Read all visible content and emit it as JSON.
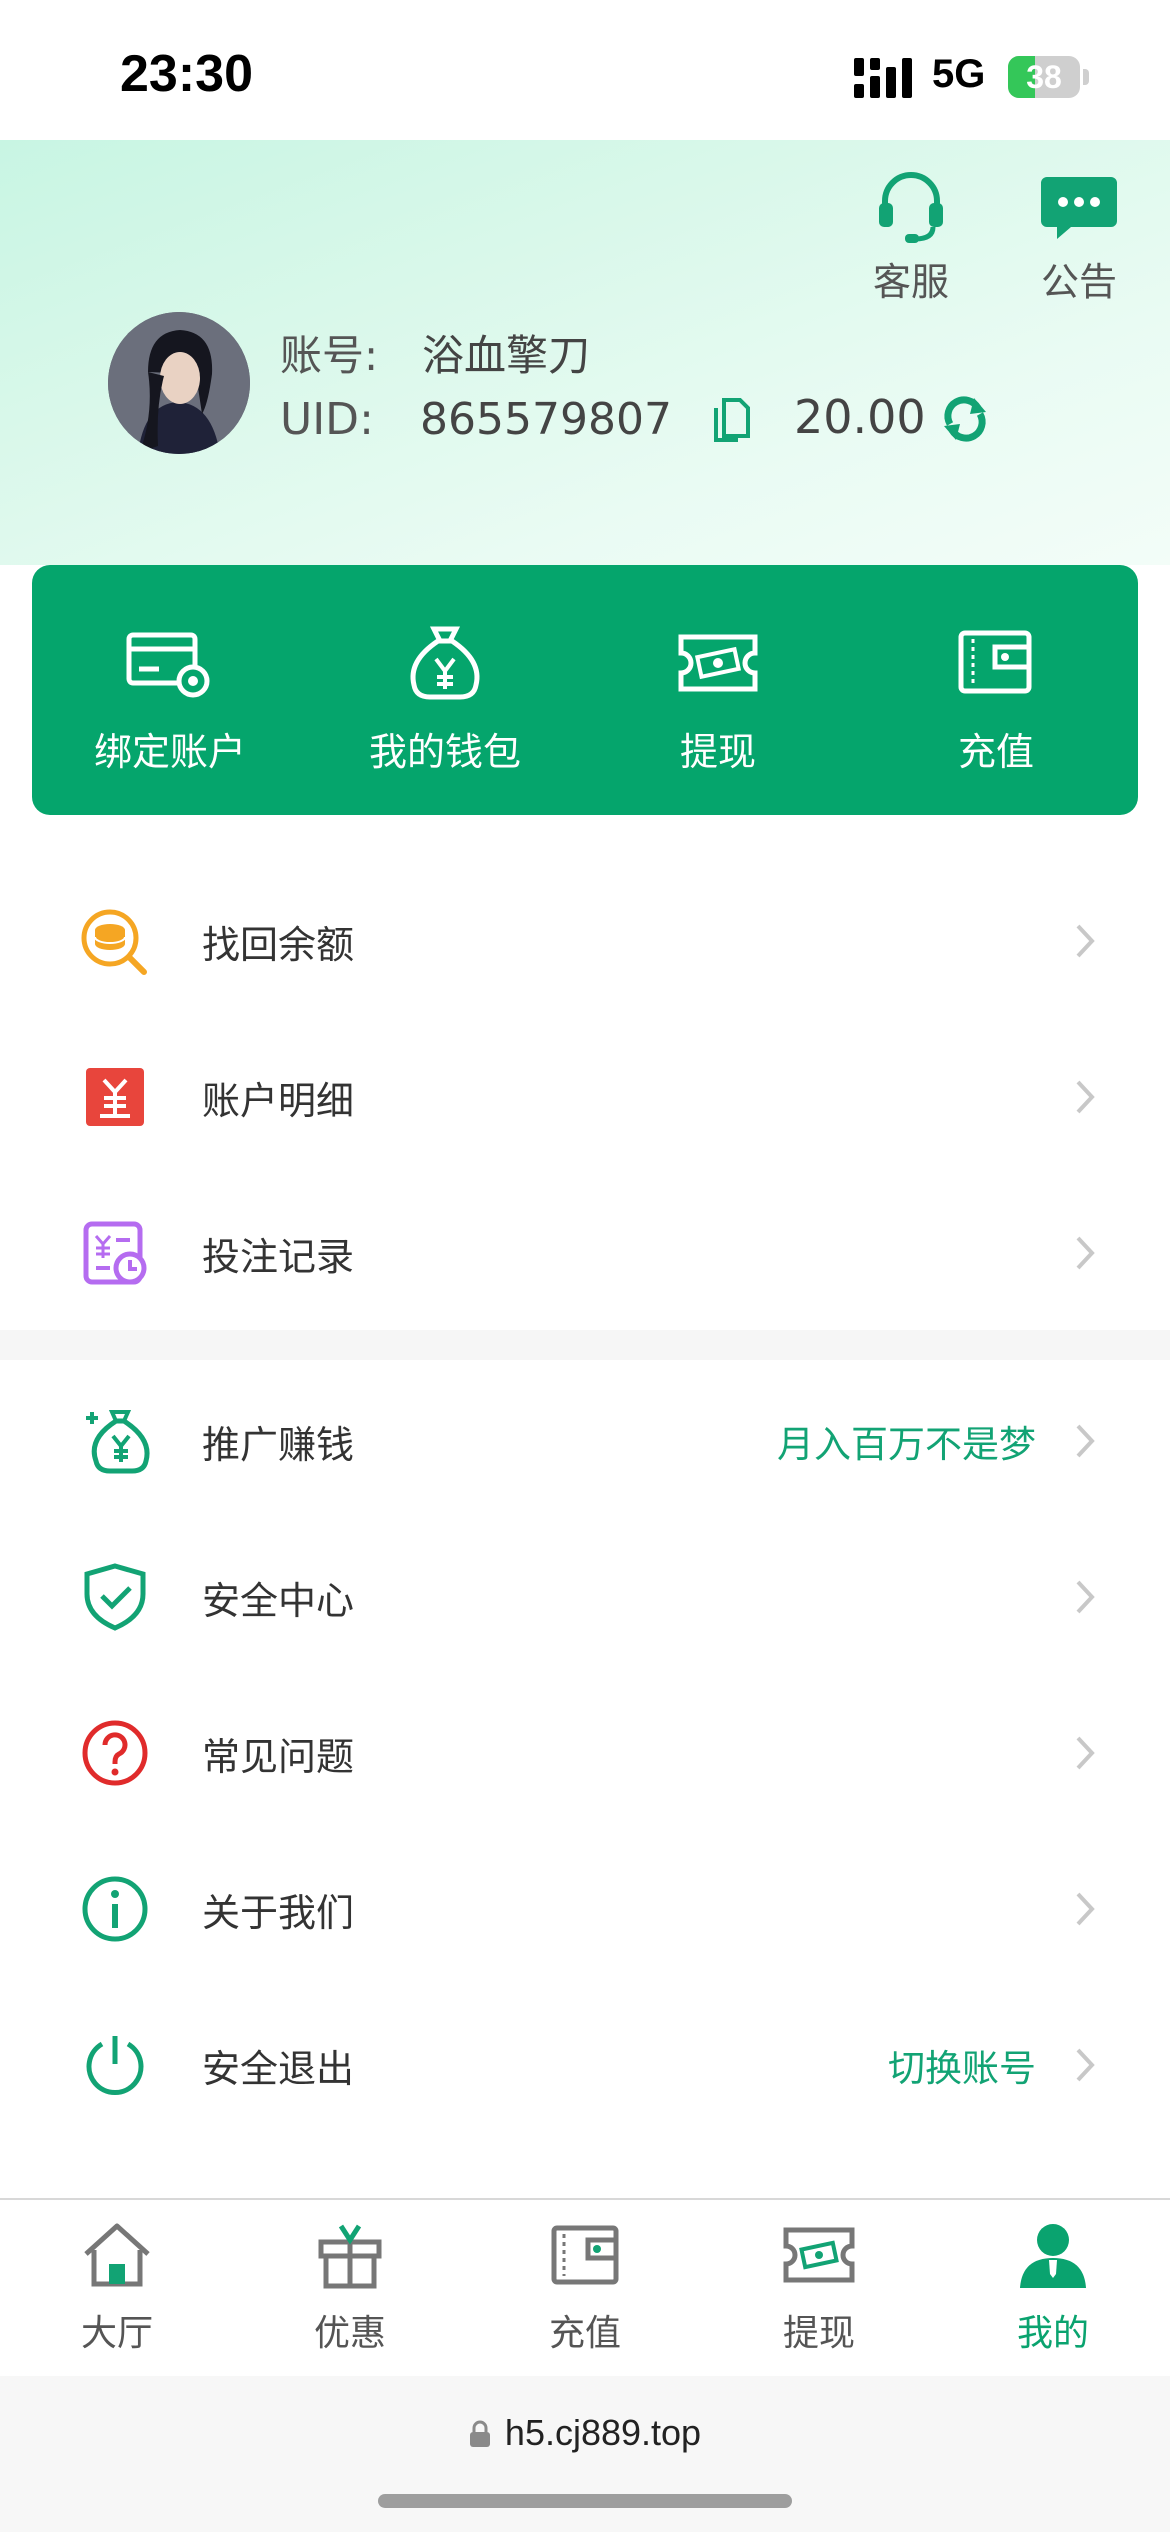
{
  "status_bar": {
    "time": "23:30",
    "network": "5G",
    "battery": "38",
    "battery_level": 0.38
  },
  "header": {
    "service_label": "客服",
    "notice_label": "公告",
    "account_label": "账号:",
    "account_name": "浴血擎刀",
    "uid_label": "UID:",
    "uid_value": "865579807",
    "balance": "20.00"
  },
  "wallet": {
    "items": [
      {
        "label": "绑定账户",
        "icon": "card-settings-icon"
      },
      {
        "label": "我的钱包",
        "icon": "money-bag-icon"
      },
      {
        "label": "提现",
        "icon": "cash-ticket-icon"
      },
      {
        "label": "充值",
        "icon": "wallet-icon"
      }
    ]
  },
  "menu1": [
    {
      "label": "找回余额",
      "icon": "coin-search-icon",
      "color": "#f5a623"
    },
    {
      "label": "账户明细",
      "icon": "yuan-receipt-icon",
      "color": "#e8453c"
    },
    {
      "label": "投注记录",
      "icon": "bet-record-icon",
      "color": "#b56cf0"
    }
  ],
  "menu2": [
    {
      "label": "推广赚钱",
      "extra": "月入百万不是梦",
      "icon": "money-plus-icon",
      "color": "#12a374"
    },
    {
      "label": "安全中心",
      "extra": "",
      "icon": "shield-check-icon",
      "color": "#12a374"
    },
    {
      "label": "常见问题",
      "extra": "",
      "icon": "question-icon",
      "color": "#e02b2b"
    },
    {
      "label": "关于我们",
      "extra": "",
      "icon": "info-icon",
      "color": "#12a374"
    },
    {
      "label": "安全退出",
      "extra": "切换账号",
      "icon": "power-icon",
      "color": "#12a374"
    }
  ],
  "tabbar": [
    {
      "label": "大厅",
      "icon": "home-icon"
    },
    {
      "label": "优惠",
      "icon": "gift-icon"
    },
    {
      "label": "充值",
      "icon": "wallet-icon"
    },
    {
      "label": "提现",
      "icon": "cash-ticket-icon"
    },
    {
      "label": "我的",
      "icon": "user-icon",
      "active": true
    }
  ],
  "browser": {
    "url": "h5.cj889.top"
  },
  "colors": {
    "brand_green": "#05a56c",
    "accent_text": "#12a374"
  }
}
